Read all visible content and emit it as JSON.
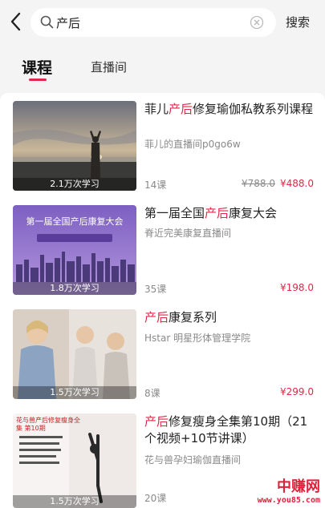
{
  "header": {
    "search_value": "产后",
    "search_button": "搜索"
  },
  "tabs": [
    {
      "label": "课程",
      "active": true
    },
    {
      "label": "直播间",
      "active": false
    }
  ],
  "courses": [
    {
      "title_pre": "菲儿",
      "title_hl": "产后",
      "title_post": "修复瑜伽私教系列课程",
      "channel": "菲儿的直播间p0go6w",
      "views": "2.1万次学习",
      "lessons": "14课",
      "original_price": "¥788.0",
      "price": "¥488.0"
    },
    {
      "title_pre": "第一届全国",
      "title_hl": "产后",
      "title_post": "康复大会",
      "channel": "脊近完美康复直播间",
      "views": "1.8万次学习",
      "lessons": "35课",
      "price": "¥198.0",
      "thumb_text": "第一届全国产后康复大会"
    },
    {
      "title_pre": "",
      "title_hl": "产后",
      "title_post": "康复系列",
      "channel": "Hstar 明星形体管理学院",
      "views": "1.5万次学习",
      "lessons": "8课",
      "price": "¥299.0"
    },
    {
      "title_pre": "",
      "title_hl": "产后",
      "title_post": "修复瘦身全集第10期（21个视频+10节讲课）",
      "channel": "花与兽孕妇瑜伽直播间",
      "views": "1.5万次学习",
      "lessons": "20课",
      "thumb_text": "花与兽产后修复瘦身全集 第10期"
    }
  ],
  "watermark": {
    "text": "中赚网",
    "url": "www.you85.com"
  },
  "colors": {
    "accent": "#e0284a",
    "background": "#f4f4f4"
  }
}
